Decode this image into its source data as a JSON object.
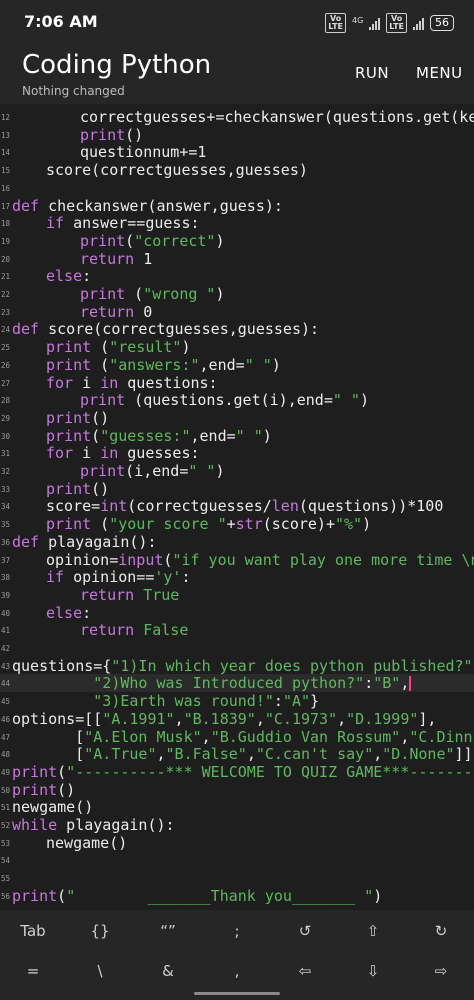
{
  "status": {
    "time": "7:06 AM",
    "battery": "56",
    "net": "4G"
  },
  "app": {
    "title": "Coding Python",
    "subtitle": "Nothing changed",
    "run": "RUN",
    "menu": "MENU"
  },
  "lines": [
    {
      "n": "12",
      "indent": 2,
      "tokens": [
        [
          "t",
          "correctguesses+=checkanswer(questions.get(key),guess)"
        ]
      ]
    },
    {
      "n": "13",
      "indent": 2,
      "tokens": [
        [
          "k",
          "print"
        ],
        [
          "t",
          "()"
        ]
      ]
    },
    {
      "n": "14",
      "indent": 2,
      "tokens": [
        [
          "t",
          "questionnum+=1"
        ]
      ]
    },
    {
      "n": "15",
      "indent": 1,
      "tokens": [
        [
          "t",
          "score(correctguesses,guesses)"
        ]
      ]
    },
    {
      "n": "16",
      "indent": 0,
      "tokens": []
    },
    {
      "n": "17",
      "indent": 0,
      "tokens": [
        [
          "k",
          "def"
        ],
        [
          "t",
          " checkanswer(answer,guess):"
        ]
      ]
    },
    {
      "n": "18",
      "indent": 1,
      "tokens": [
        [
          "k",
          "if"
        ],
        [
          "t",
          " answer==guess:"
        ]
      ]
    },
    {
      "n": "19",
      "indent": 2,
      "tokens": [
        [
          "k",
          "print"
        ],
        [
          "t",
          "("
        ],
        [
          "s",
          "\"correct\""
        ],
        [
          "t",
          ")"
        ]
      ]
    },
    {
      "n": "20",
      "indent": 2,
      "tokens": [
        [
          "k",
          "return"
        ],
        [
          "t",
          " 1"
        ]
      ]
    },
    {
      "n": "21",
      "indent": 1,
      "tokens": [
        [
          "k",
          "else"
        ],
        [
          "t",
          ":"
        ]
      ]
    },
    {
      "n": "22",
      "indent": 2,
      "tokens": [
        [
          "k",
          "print"
        ],
        [
          "t",
          " ("
        ],
        [
          "s",
          "\"wrong \""
        ],
        [
          "t",
          ")"
        ]
      ]
    },
    {
      "n": "23",
      "indent": 2,
      "tokens": [
        [
          "k",
          "return"
        ],
        [
          "t",
          " 0"
        ]
      ]
    },
    {
      "n": "24",
      "indent": 0,
      "tokens": [
        [
          "k",
          "def"
        ],
        [
          "t",
          " score(correctguesses,guesses):"
        ]
      ]
    },
    {
      "n": "25",
      "indent": 1,
      "tokens": [
        [
          "k",
          "print"
        ],
        [
          "t",
          " ("
        ],
        [
          "s",
          "\"result\""
        ],
        [
          "t",
          ")"
        ]
      ]
    },
    {
      "n": "26",
      "indent": 1,
      "tokens": [
        [
          "k",
          "print"
        ],
        [
          "t",
          " ("
        ],
        [
          "s",
          "\"answers:\""
        ],
        [
          "t",
          ",end="
        ],
        [
          "s",
          "\" \""
        ],
        [
          "t",
          ")"
        ]
      ]
    },
    {
      "n": "27",
      "indent": 1,
      "tokens": [
        [
          "k",
          "for"
        ],
        [
          "t",
          " i "
        ],
        [
          "k",
          "in"
        ],
        [
          "t",
          " questions:"
        ]
      ]
    },
    {
      "n": "28",
      "indent": 2,
      "tokens": [
        [
          "k",
          "print"
        ],
        [
          "t",
          " (questions.get(i),end="
        ],
        [
          "s",
          "\" \""
        ],
        [
          "t",
          ")"
        ]
      ]
    },
    {
      "n": "29",
      "indent": 1,
      "tokens": [
        [
          "k",
          "print"
        ],
        [
          "t",
          "()"
        ]
      ]
    },
    {
      "n": "30",
      "indent": 1,
      "tokens": [
        [
          "k",
          "print"
        ],
        [
          "t",
          "("
        ],
        [
          "s",
          "\"guesses:\""
        ],
        [
          "t",
          ",end="
        ],
        [
          "s",
          "\" \""
        ],
        [
          "t",
          ")"
        ]
      ]
    },
    {
      "n": "31",
      "indent": 1,
      "tokens": [
        [
          "k",
          "for"
        ],
        [
          "t",
          " i "
        ],
        [
          "k",
          "in"
        ],
        [
          "t",
          " guesses:"
        ]
      ]
    },
    {
      "n": "32",
      "indent": 2,
      "tokens": [
        [
          "k",
          "print"
        ],
        [
          "t",
          "(i,end="
        ],
        [
          "s",
          "\" \""
        ],
        [
          "t",
          ")"
        ]
      ]
    },
    {
      "n": "33",
      "indent": 1,
      "tokens": [
        [
          "k",
          "print"
        ],
        [
          "t",
          "()"
        ]
      ]
    },
    {
      "n": "34",
      "indent": 1,
      "tokens": [
        [
          "t",
          "score="
        ],
        [
          "k",
          "int"
        ],
        [
          "t",
          "(correctguesses/"
        ],
        [
          "k",
          "len"
        ],
        [
          "t",
          "(questions))*100"
        ]
      ]
    },
    {
      "n": "35",
      "indent": 1,
      "tokens": [
        [
          "k",
          "print"
        ],
        [
          "t",
          " ("
        ],
        [
          "s",
          "\"your score \""
        ],
        [
          "t",
          "+"
        ],
        [
          "k",
          "str"
        ],
        [
          "t",
          "(score)+"
        ],
        [
          "s",
          "\"%\""
        ],
        [
          "t",
          ")"
        ]
      ]
    },
    {
      "n": "36",
      "indent": 0,
      "tokens": [
        [
          "k",
          "def"
        ],
        [
          "t",
          " playagain():"
        ]
      ]
    },
    {
      "n": "37",
      "indent": 1,
      "tokens": [
        [
          "t",
          "opinion="
        ],
        [
          "k",
          "input"
        ],
        [
          "t",
          "("
        ],
        [
          "s",
          "\"if you want play one more time \\nenter y\""
        ]
      ]
    },
    {
      "n": "38",
      "indent": 1,
      "tokens": [
        [
          "k",
          "if"
        ],
        [
          "t",
          " opinion=="
        ],
        [
          "s",
          "'y'"
        ],
        [
          "t",
          ":"
        ]
      ]
    },
    {
      "n": "39",
      "indent": 2,
      "tokens": [
        [
          "k",
          "return"
        ],
        [
          "t",
          " "
        ],
        [
          "s",
          "True"
        ]
      ]
    },
    {
      "n": "40",
      "indent": 1,
      "tokens": [
        [
          "k",
          "else"
        ],
        [
          "t",
          ":"
        ]
      ]
    },
    {
      "n": "41",
      "indent": 2,
      "tokens": [
        [
          "k",
          "return"
        ],
        [
          "t",
          " "
        ],
        [
          "s",
          "False"
        ]
      ]
    },
    {
      "n": "42",
      "indent": 0,
      "tokens": []
    },
    {
      "n": "43",
      "indent": 0,
      "tokens": [
        [
          "t",
          "questions={"
        ],
        [
          "s",
          "\"1)In which year does python published?\""
        ],
        [
          "t",
          ":"
        ],
        [
          "s",
          "\"A\""
        ],
        [
          "t",
          ","
        ]
      ]
    },
    {
      "n": "44",
      "indent": 0,
      "pad": "         ",
      "cursor": true,
      "tokens": [
        [
          "s",
          "\"2)Who was Introduced python?\""
        ],
        [
          "t",
          ":"
        ],
        [
          "s",
          "\"B\""
        ],
        [
          "t",
          ","
        ]
      ]
    },
    {
      "n": "45",
      "indent": 0,
      "pad": "         ",
      "tokens": [
        [
          "s",
          "\"3)Earth was round!\""
        ],
        [
          "t",
          ":"
        ],
        [
          "s",
          "\"A\""
        ],
        [
          "t",
          "}"
        ]
      ]
    },
    {
      "n": "46",
      "indent": 0,
      "tokens": [
        [
          "t",
          "options=[["
        ],
        [
          "s",
          "\"A.1991\""
        ],
        [
          "t",
          ","
        ],
        [
          "s",
          "\"B.1839\""
        ],
        [
          "t",
          ","
        ],
        [
          "s",
          "\"C.1973\""
        ],
        [
          "t",
          ","
        ],
        [
          "s",
          "\"D.1999\""
        ],
        [
          "t",
          "],"
        ]
      ]
    },
    {
      "n": "47",
      "indent": 0,
      "pad": "       ",
      "tokens": [
        [
          "t",
          "["
        ],
        [
          "s",
          "\"A.Elon Musk\""
        ],
        [
          "t",
          ","
        ],
        [
          "s",
          "\"B.Guddio Van Rossum\""
        ],
        [
          "t",
          ","
        ],
        [
          "s",
          "\"C.Dinnis Richie\""
        ]
      ]
    },
    {
      "n": "48",
      "indent": 0,
      "pad": "       ",
      "tokens": [
        [
          "t",
          "["
        ],
        [
          "s",
          "\"A.True\""
        ],
        [
          "t",
          ","
        ],
        [
          "s",
          "\"B.False\""
        ],
        [
          "t",
          ","
        ],
        [
          "s",
          "\"C.can't say\""
        ],
        [
          "t",
          ","
        ],
        [
          "s",
          "\"D.None\""
        ],
        [
          "t",
          "]]"
        ]
      ]
    },
    {
      "n": "49",
      "indent": 0,
      "tokens": [
        [
          "k",
          "print"
        ],
        [
          "t",
          "("
        ],
        [
          "s",
          "\"----------*** WELCOME TO QUIZ GAME***-----------\""
        ]
      ]
    },
    {
      "n": "50",
      "indent": 0,
      "tokens": [
        [
          "k",
          "print"
        ],
        [
          "t",
          "()"
        ]
      ]
    },
    {
      "n": "51",
      "indent": 0,
      "tokens": [
        [
          "t",
          "newgame()"
        ]
      ]
    },
    {
      "n": "52",
      "indent": 0,
      "tokens": [
        [
          "k",
          "while"
        ],
        [
          "t",
          " playagain():"
        ]
      ]
    },
    {
      "n": "53",
      "indent": 1,
      "tokens": [
        [
          "t",
          "newgame()"
        ]
      ]
    },
    {
      "n": "54",
      "indent": 0,
      "tokens": []
    },
    {
      "n": "55",
      "indent": 0,
      "tokens": []
    },
    {
      "n": "56",
      "indent": 0,
      "tokens": [
        [
          "k",
          "print"
        ],
        [
          "t",
          "("
        ],
        [
          "s",
          "\"        _______Thank you_______ \""
        ],
        [
          "t",
          ")"
        ]
      ]
    }
  ],
  "keys_row1": [
    "Tab",
    "{}",
    "“”",
    ";",
    "↺",
    "⇧",
    "↻"
  ],
  "keys_row2": [
    "=",
    "\\",
    "&",
    ",",
    "⇦",
    "⇩",
    "⇨"
  ],
  "colors": {
    "background": "#1e1e1e",
    "keyword": "#c678dd",
    "string": "#5fb85f",
    "cursor": "#ff3d8f"
  }
}
